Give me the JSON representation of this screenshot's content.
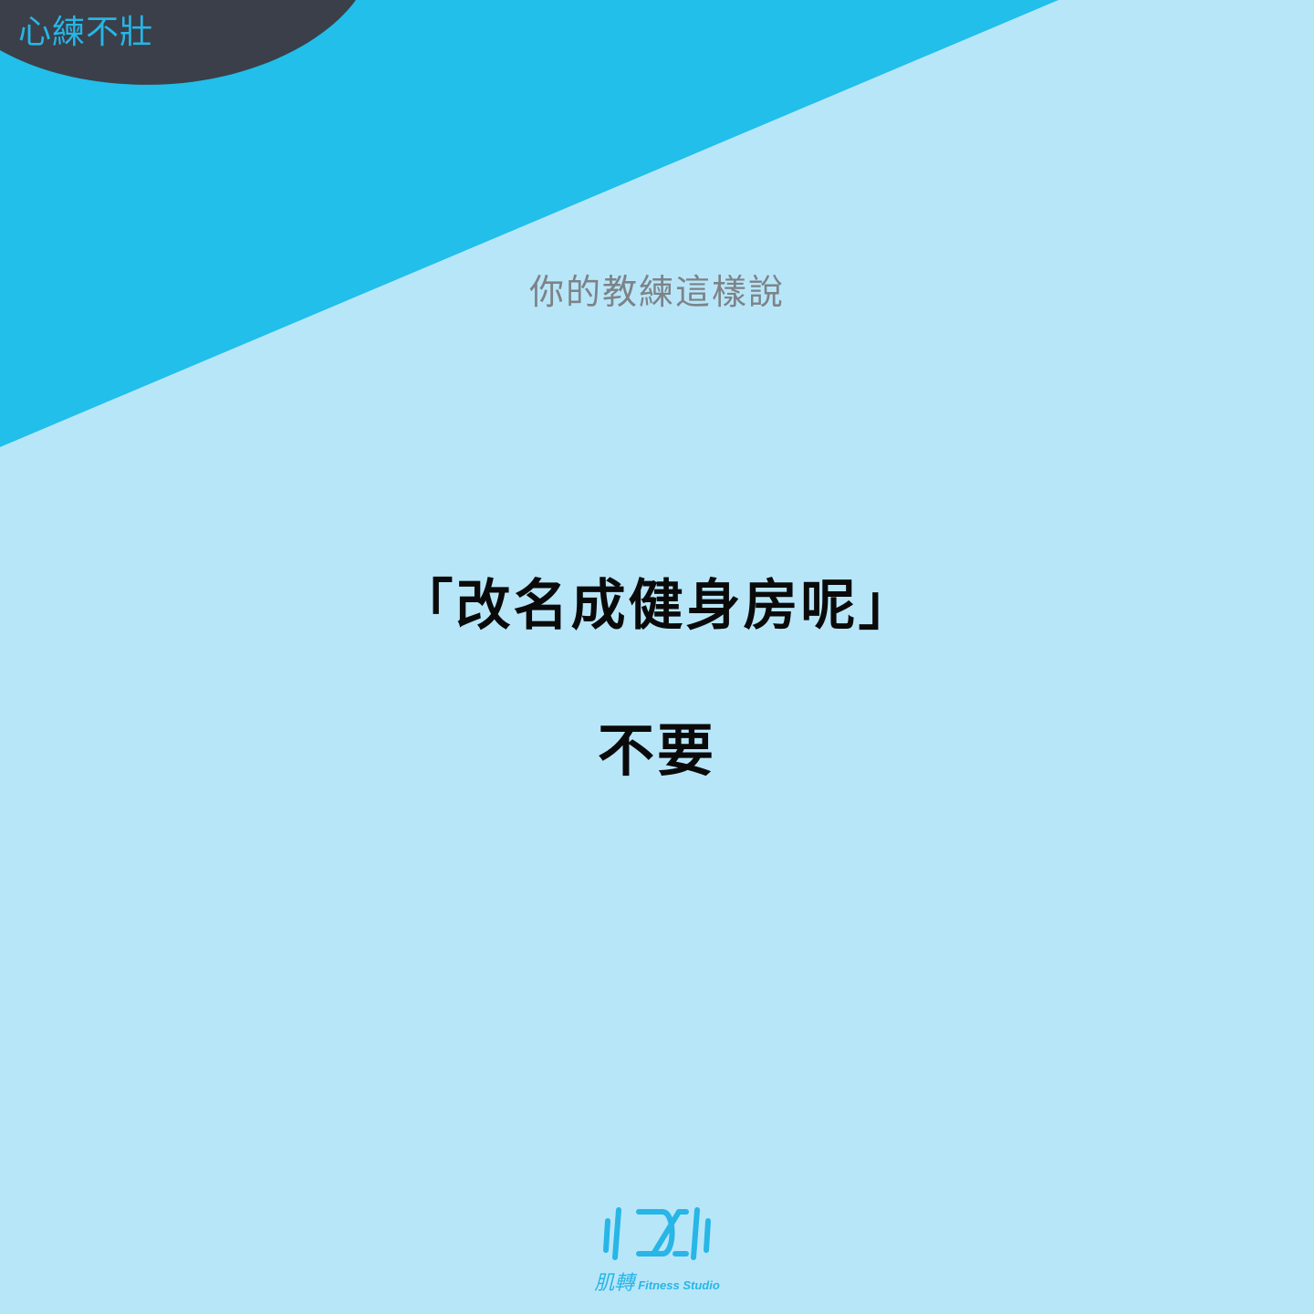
{
  "colors": {
    "background": "#b8e6f9",
    "band": "#21bfea",
    "dark_blob": "#3a3f4a",
    "accent": "#27b6e6",
    "subtitle": "#7c8388",
    "text": "#0a0a0a"
  },
  "corner_tag": "心練不壯",
  "subtitle": "你的教練這樣說",
  "quote": "「改名成健身房呢」",
  "answer": "不要",
  "logo": {
    "icon": "dumbbell-logo-icon",
    "chinese": "肌轉",
    "english": "Fitness Studio"
  }
}
